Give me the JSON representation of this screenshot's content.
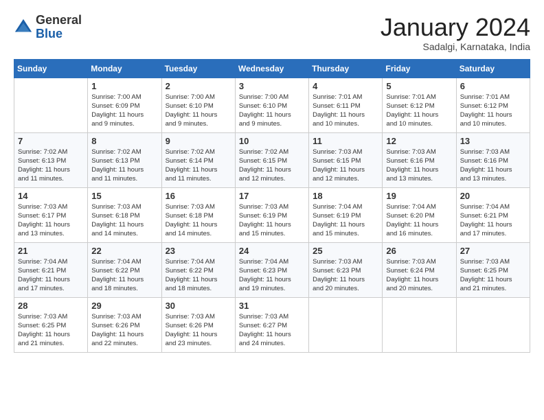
{
  "header": {
    "logo_general": "General",
    "logo_blue": "Blue",
    "month_title": "January 2024",
    "subtitle": "Sadalgi, Karnataka, India"
  },
  "days_of_week": [
    "Sunday",
    "Monday",
    "Tuesday",
    "Wednesday",
    "Thursday",
    "Friday",
    "Saturday"
  ],
  "weeks": [
    [
      {
        "day": "",
        "info": ""
      },
      {
        "day": "1",
        "info": "Sunrise: 7:00 AM\nSunset: 6:09 PM\nDaylight: 11 hours\nand 9 minutes."
      },
      {
        "day": "2",
        "info": "Sunrise: 7:00 AM\nSunset: 6:10 PM\nDaylight: 11 hours\nand 9 minutes."
      },
      {
        "day": "3",
        "info": "Sunrise: 7:00 AM\nSunset: 6:10 PM\nDaylight: 11 hours\nand 9 minutes."
      },
      {
        "day": "4",
        "info": "Sunrise: 7:01 AM\nSunset: 6:11 PM\nDaylight: 11 hours\nand 10 minutes."
      },
      {
        "day": "5",
        "info": "Sunrise: 7:01 AM\nSunset: 6:12 PM\nDaylight: 11 hours\nand 10 minutes."
      },
      {
        "day": "6",
        "info": "Sunrise: 7:01 AM\nSunset: 6:12 PM\nDaylight: 11 hours\nand 10 minutes."
      }
    ],
    [
      {
        "day": "7",
        "info": "Sunrise: 7:02 AM\nSunset: 6:13 PM\nDaylight: 11 hours\nand 11 minutes."
      },
      {
        "day": "8",
        "info": "Sunrise: 7:02 AM\nSunset: 6:13 PM\nDaylight: 11 hours\nand 11 minutes."
      },
      {
        "day": "9",
        "info": "Sunrise: 7:02 AM\nSunset: 6:14 PM\nDaylight: 11 hours\nand 11 minutes."
      },
      {
        "day": "10",
        "info": "Sunrise: 7:02 AM\nSunset: 6:15 PM\nDaylight: 11 hours\nand 12 minutes."
      },
      {
        "day": "11",
        "info": "Sunrise: 7:03 AM\nSunset: 6:15 PM\nDaylight: 11 hours\nand 12 minutes."
      },
      {
        "day": "12",
        "info": "Sunrise: 7:03 AM\nSunset: 6:16 PM\nDaylight: 11 hours\nand 13 minutes."
      },
      {
        "day": "13",
        "info": "Sunrise: 7:03 AM\nSunset: 6:16 PM\nDaylight: 11 hours\nand 13 minutes."
      }
    ],
    [
      {
        "day": "14",
        "info": "Sunrise: 7:03 AM\nSunset: 6:17 PM\nDaylight: 11 hours\nand 13 minutes."
      },
      {
        "day": "15",
        "info": "Sunrise: 7:03 AM\nSunset: 6:18 PM\nDaylight: 11 hours\nand 14 minutes."
      },
      {
        "day": "16",
        "info": "Sunrise: 7:03 AM\nSunset: 6:18 PM\nDaylight: 11 hours\nand 14 minutes."
      },
      {
        "day": "17",
        "info": "Sunrise: 7:03 AM\nSunset: 6:19 PM\nDaylight: 11 hours\nand 15 minutes."
      },
      {
        "day": "18",
        "info": "Sunrise: 7:04 AM\nSunset: 6:19 PM\nDaylight: 11 hours\nand 15 minutes."
      },
      {
        "day": "19",
        "info": "Sunrise: 7:04 AM\nSunset: 6:20 PM\nDaylight: 11 hours\nand 16 minutes."
      },
      {
        "day": "20",
        "info": "Sunrise: 7:04 AM\nSunset: 6:21 PM\nDaylight: 11 hours\nand 17 minutes."
      }
    ],
    [
      {
        "day": "21",
        "info": "Sunrise: 7:04 AM\nSunset: 6:21 PM\nDaylight: 11 hours\nand 17 minutes."
      },
      {
        "day": "22",
        "info": "Sunrise: 7:04 AM\nSunset: 6:22 PM\nDaylight: 11 hours\nand 18 minutes."
      },
      {
        "day": "23",
        "info": "Sunrise: 7:04 AM\nSunset: 6:22 PM\nDaylight: 11 hours\nand 18 minutes."
      },
      {
        "day": "24",
        "info": "Sunrise: 7:04 AM\nSunset: 6:23 PM\nDaylight: 11 hours\nand 19 minutes."
      },
      {
        "day": "25",
        "info": "Sunrise: 7:03 AM\nSunset: 6:23 PM\nDaylight: 11 hours\nand 20 minutes."
      },
      {
        "day": "26",
        "info": "Sunrise: 7:03 AM\nSunset: 6:24 PM\nDaylight: 11 hours\nand 20 minutes."
      },
      {
        "day": "27",
        "info": "Sunrise: 7:03 AM\nSunset: 6:25 PM\nDaylight: 11 hours\nand 21 minutes."
      }
    ],
    [
      {
        "day": "28",
        "info": "Sunrise: 7:03 AM\nSunset: 6:25 PM\nDaylight: 11 hours\nand 21 minutes."
      },
      {
        "day": "29",
        "info": "Sunrise: 7:03 AM\nSunset: 6:26 PM\nDaylight: 11 hours\nand 22 minutes."
      },
      {
        "day": "30",
        "info": "Sunrise: 7:03 AM\nSunset: 6:26 PM\nDaylight: 11 hours\nand 23 minutes."
      },
      {
        "day": "31",
        "info": "Sunrise: 7:03 AM\nSunset: 6:27 PM\nDaylight: 11 hours\nand 24 minutes."
      },
      {
        "day": "",
        "info": ""
      },
      {
        "day": "",
        "info": ""
      },
      {
        "day": "",
        "info": ""
      }
    ]
  ]
}
